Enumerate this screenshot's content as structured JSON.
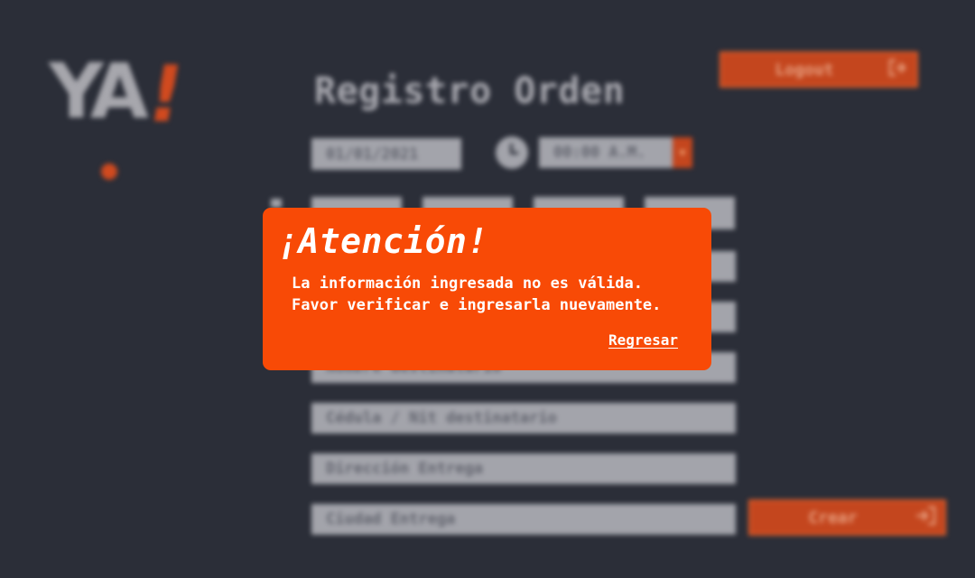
{
  "brand": {
    "logo_text": "YA",
    "logo_mark": "!"
  },
  "header": {
    "title": "Registro Orden",
    "logout_label": "Logout",
    "logout_icon": "logout-icon"
  },
  "form": {
    "date_value": "01/01/2021",
    "time_value": "00:00 A.M.",
    "clock_icon": "clock-icon",
    "fields": [
      "",
      "",
      "Nombre destinatario",
      "Cédula / Nit destinatario",
      "Dirección Entrega",
      "Ciudad Entrega"
    ],
    "create_label": "Crear",
    "create_icon": "login-arrow-icon"
  },
  "modal": {
    "title": "¡Atención!",
    "message": "La información ingresada no es válida.\nFavor verificar e ingresarla nuevamente.",
    "link_label": "Regresar"
  },
  "colors": {
    "background": "#2b2e38",
    "accent": "#f84a06",
    "field": "#a3a4ab"
  }
}
